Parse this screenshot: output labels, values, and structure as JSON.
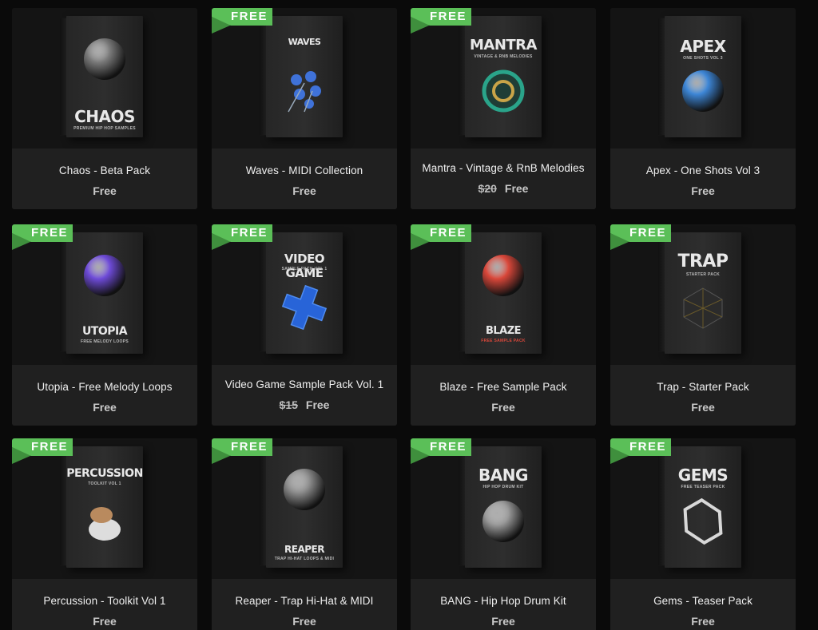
{
  "ribbon_label": "FREE",
  "products": [
    {
      "title": "Chaos - Beta Pack",
      "old_price": "",
      "price": "Free",
      "free_badge": false,
      "box_name": "CHAOS",
      "box_sub": "PREMIUM HIP HOP SAMPLES",
      "art_icon": "skull-icon",
      "art_color": "#7a7a7a"
    },
    {
      "title": "Waves - MIDI Collection",
      "old_price": "",
      "price": "Free",
      "free_badge": true,
      "box_name": "WAVES",
      "box_sub": "",
      "art_icon": "flower-icon",
      "art_color": "#3f72d9"
    },
    {
      "title": "Mantra - Vintage & RnB Melodies",
      "old_price": "$20",
      "price": "Free",
      "free_badge": true,
      "box_name": "MANTRA",
      "box_sub": "VINTAGE & RNB MELODIES",
      "art_icon": "ring-icon",
      "art_color": "#2aa48a"
    },
    {
      "title": "Apex - One Shots Vol 3",
      "old_price": "",
      "price": "Free",
      "free_badge": false,
      "box_name": "APEX",
      "box_sub": "ONE SHOTS VOL 3",
      "art_icon": "knot-icon",
      "art_color": "#3d86d6"
    },
    {
      "title": "Utopia - Free Melody Loops",
      "old_price": "",
      "price": "Free",
      "free_badge": true,
      "box_name": "UTOPIA",
      "box_sub": "FREE MELODY LOOPS",
      "art_icon": "sphere-icon",
      "art_color": "#6e4bd8"
    },
    {
      "title": "Video Game Sample Pack Vol. 1",
      "old_price": "$15",
      "price": "Free",
      "free_badge": true,
      "box_name": "VIDEO GAME",
      "box_sub": "SAMPLE PACK VOL 1",
      "art_icon": "cross-icon",
      "art_color": "#2864d8"
    },
    {
      "title": "Blaze - Free Sample Pack",
      "old_price": "",
      "price": "Free",
      "free_badge": true,
      "box_name": "BLAZE",
      "box_sub": "FREE SAMPLE PACK",
      "art_icon": "spiked-ball-icon",
      "art_color": "#d9473a"
    },
    {
      "title": "Trap - Starter Pack",
      "old_price": "",
      "price": "Free",
      "free_badge": true,
      "box_name": "TRAP",
      "box_sub": "STARTER PACK",
      "art_icon": "cube-icon",
      "art_color": "#3a3a3a"
    },
    {
      "title": "Percussion - Toolkit Vol 1",
      "old_price": "",
      "price": "Free",
      "free_badge": true,
      "box_name": "PERCUSSION",
      "box_sub": "TOOLKIT VOL 1",
      "art_icon": "drum-icon",
      "art_color": "#b98a5e"
    },
    {
      "title": "Reaper - Trap Hi-Hat & MIDI",
      "old_price": "",
      "price": "Free",
      "free_badge": true,
      "box_name": "REAPER",
      "box_sub": "TRAP HI-HAT LOOPS & MIDI",
      "art_icon": "shard-icon",
      "art_color": "#8c8c8c"
    },
    {
      "title": "BANG - Hip Hop Drum Kit",
      "old_price": "",
      "price": "Free",
      "free_badge": true,
      "box_name": "BANG",
      "box_sub": "HIP HOP DRUM KIT",
      "art_icon": "glass-cube-icon",
      "art_color": "#9a9a9a"
    },
    {
      "title": "Gems - Teaser Pack",
      "old_price": "",
      "price": "Free",
      "free_badge": true,
      "box_name": "GEMS",
      "box_sub": "FREE TEASER PACK",
      "art_icon": "gem-icon",
      "art_color": "#d8d8d8"
    }
  ]
}
